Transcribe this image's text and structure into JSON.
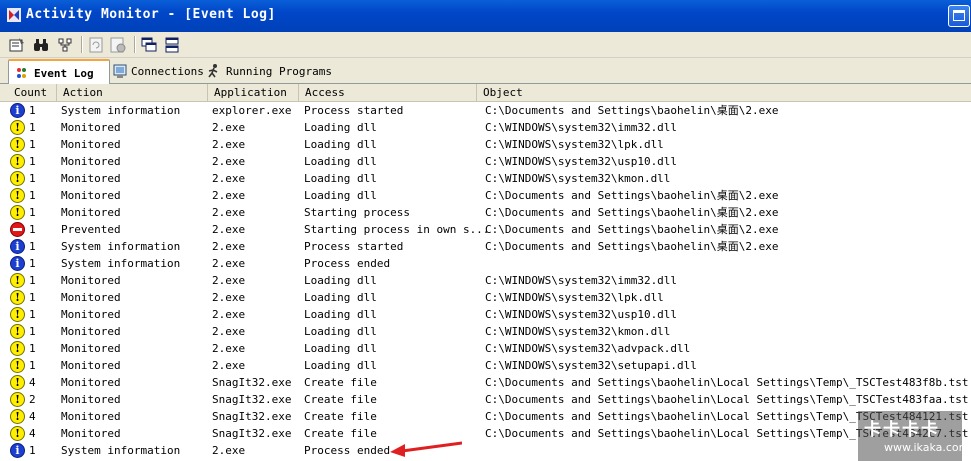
{
  "window": {
    "title": "Activity Monitor - [Event Log]",
    "icons": [
      "app-icon",
      "maximize-icon"
    ]
  },
  "toolbar": {
    "buttons": [
      {
        "name": "properties-icon"
      },
      {
        "name": "find-icon"
      },
      {
        "name": "filter-icon"
      },
      {
        "name": "refresh-icon"
      },
      {
        "name": "settings-icon"
      },
      {
        "name": "cascade-windows-icon"
      },
      {
        "name": "tile-windows-icon"
      }
    ]
  },
  "tabs": [
    {
      "label": "Event Log",
      "icon": "event-log-icon",
      "active": true
    },
    {
      "label": "Connections",
      "icon": "connections-icon",
      "active": false
    },
    {
      "label": "Running Programs",
      "icon": "running-programs-icon",
      "active": false
    }
  ],
  "table": {
    "headers": [
      "Count",
      "Action",
      "Application",
      "Access",
      "Object"
    ],
    "rows": [
      {
        "type": "info",
        "count": "1",
        "action": "System information",
        "app": "explorer.exe",
        "access": "Process started",
        "object": "C:\\Documents and Settings\\baohelin\\桌面\\2.exe"
      },
      {
        "type": "warn",
        "count": "1",
        "action": "Monitored",
        "app": "2.exe",
        "access": "Loading dll",
        "object": "C:\\WINDOWS\\system32\\imm32.dll"
      },
      {
        "type": "warn",
        "count": "1",
        "action": "Monitored",
        "app": "2.exe",
        "access": "Loading dll",
        "object": "C:\\WINDOWS\\system32\\lpk.dll"
      },
      {
        "type": "warn",
        "count": "1",
        "action": "Monitored",
        "app": "2.exe",
        "access": "Loading dll",
        "object": "C:\\WINDOWS\\system32\\usp10.dll"
      },
      {
        "type": "warn",
        "count": "1",
        "action": "Monitored",
        "app": "2.exe",
        "access": "Loading dll",
        "object": "C:\\WINDOWS\\system32\\kmon.dll"
      },
      {
        "type": "warn",
        "count": "1",
        "action": "Monitored",
        "app": "2.exe",
        "access": "Loading dll",
        "object": "C:\\Documents and Settings\\baohelin\\桌面\\2.exe"
      },
      {
        "type": "warn",
        "count": "1",
        "action": "Monitored",
        "app": "2.exe",
        "access": "Starting process",
        "object": "C:\\Documents and Settings\\baohelin\\桌面\\2.exe"
      },
      {
        "type": "stop",
        "count": "1",
        "action": "Prevented",
        "app": "2.exe",
        "access": "Starting process in own s...",
        "object": "C:\\Documents and Settings\\baohelin\\桌面\\2.exe"
      },
      {
        "type": "info",
        "count": "1",
        "action": "System information",
        "app": "2.exe",
        "access": "Process started",
        "object": "C:\\Documents and Settings\\baohelin\\桌面\\2.exe"
      },
      {
        "type": "info",
        "count": "1",
        "action": "System information",
        "app": "2.exe",
        "access": "Process ended",
        "object": ""
      },
      {
        "type": "warn",
        "count": "1",
        "action": "Monitored",
        "app": "2.exe",
        "access": "Loading dll",
        "object": "C:\\WINDOWS\\system32\\imm32.dll"
      },
      {
        "type": "warn",
        "count": "1",
        "action": "Monitored",
        "app": "2.exe",
        "access": "Loading dll",
        "object": "C:\\WINDOWS\\system32\\lpk.dll"
      },
      {
        "type": "warn",
        "count": "1",
        "action": "Monitored",
        "app": "2.exe",
        "access": "Loading dll",
        "object": "C:\\WINDOWS\\system32\\usp10.dll"
      },
      {
        "type": "warn",
        "count": "1",
        "action": "Monitored",
        "app": "2.exe",
        "access": "Loading dll",
        "object": "C:\\WINDOWS\\system32\\kmon.dll"
      },
      {
        "type": "warn",
        "count": "1",
        "action": "Monitored",
        "app": "2.exe",
        "access": "Loading dll",
        "object": "C:\\WINDOWS\\system32\\advpack.dll"
      },
      {
        "type": "warn",
        "count": "1",
        "action": "Monitored",
        "app": "2.exe",
        "access": "Loading dll",
        "object": "C:\\WINDOWS\\system32\\setupapi.dll"
      },
      {
        "type": "warn",
        "count": "4",
        "action": "Monitored",
        "app": "SnagIt32.exe",
        "access": "Create file",
        "object": "C:\\Documents and Settings\\baohelin\\Local Settings\\Temp\\_TSCTest483f8b.tst"
      },
      {
        "type": "warn",
        "count": "2",
        "action": "Monitored",
        "app": "SnagIt32.exe",
        "access": "Create file",
        "object": "C:\\Documents and Settings\\baohelin\\Local Settings\\Temp\\_TSCTest483faa.tst"
      },
      {
        "type": "warn",
        "count": "4",
        "action": "Monitored",
        "app": "SnagIt32.exe",
        "access": "Create file",
        "object": "C:\\Documents and Settings\\baohelin\\Local Settings\\Temp\\_TSCTest484121.tst"
      },
      {
        "type": "warn",
        "count": "4",
        "action": "Monitored",
        "app": "SnagIt32.exe",
        "access": "Create file",
        "object": "C:\\Documents and Settings\\baohelin\\Local Settings\\Temp\\_TSCTest4842c7.tst"
      },
      {
        "type": "info",
        "count": "1",
        "action": "System information",
        "app": "2.exe",
        "access": "Process ended",
        "object": ""
      }
    ]
  },
  "annotation": {
    "arrow_color": "#e02020"
  },
  "watermark": {
    "main": "卡卡卡卡",
    "url": "www.ikaka.com"
  },
  "colors": {
    "titlebar": "#0046c8",
    "info": "#1d3fd0",
    "warn": "#ffee00",
    "stop": "#e01818"
  }
}
